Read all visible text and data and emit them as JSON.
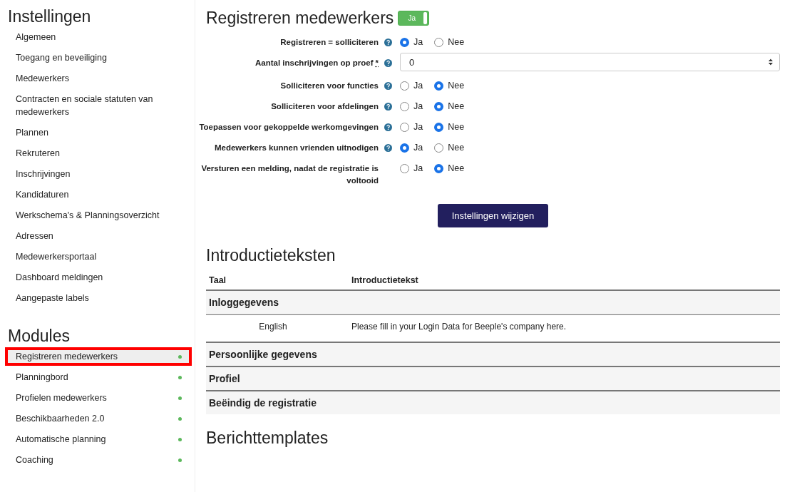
{
  "sidebar": {
    "sections": [
      {
        "title": "Instellingen",
        "items": [
          {
            "label": "Algemeen",
            "selected": false
          },
          {
            "label": "Toegang en beveiliging",
            "selected": false
          },
          {
            "label": "Medewerkers",
            "selected": false
          },
          {
            "label": "Contracten en sociale statuten van medewerkers",
            "selected": false
          },
          {
            "label": "Plannen",
            "selected": false
          },
          {
            "label": "Rekruteren",
            "selected": false
          },
          {
            "label": "Inschrijvingen",
            "selected": false
          },
          {
            "label": "Kandidaturen",
            "selected": false
          },
          {
            "label": "Werkschema's & Planningsoverzicht",
            "selected": false
          },
          {
            "label": "Adressen",
            "selected": false
          },
          {
            "label": "Medewerkersportaal",
            "selected": false
          },
          {
            "label": "Dashboard meldingen",
            "selected": false
          },
          {
            "label": "Aangepaste labels",
            "selected": false
          }
        ]
      },
      {
        "title": "Modules",
        "items": [
          {
            "label": "Registreren medewerkers",
            "selected": true,
            "active": true
          },
          {
            "label": "Planningbord",
            "selected": false,
            "active": true
          },
          {
            "label": "Profielen medewerkers",
            "selected": false,
            "active": true
          },
          {
            "label": "Beschikbaarheden 2.0",
            "selected": false,
            "active": true
          },
          {
            "label": "Automatische planning",
            "selected": false,
            "active": true
          },
          {
            "label": "Coaching",
            "selected": false,
            "active": true
          }
        ]
      }
    ]
  },
  "main": {
    "title": "Registreren medewerkers",
    "toggle": {
      "label": "Ja",
      "on": true
    },
    "settings": [
      {
        "kind": "radio",
        "label": "Registreren = solliciteren",
        "help": true,
        "options": [
          {
            "label": "Ja",
            "selected": true
          },
          {
            "label": "Nee",
            "selected": false
          }
        ]
      },
      {
        "kind": "number",
        "label": "Aantal inschrijvingen op proef",
        "required_mark": "*",
        "help": true,
        "value": "0"
      },
      {
        "kind": "radio",
        "label": "Solliciteren voor functies",
        "help": true,
        "options": [
          {
            "label": "Ja",
            "selected": false
          },
          {
            "label": "Nee",
            "selected": true
          }
        ]
      },
      {
        "kind": "radio",
        "label": "Solliciteren voor afdelingen",
        "help": true,
        "options": [
          {
            "label": "Ja",
            "selected": false
          },
          {
            "label": "Nee",
            "selected": true
          }
        ]
      },
      {
        "kind": "radio",
        "label": "Toepassen voor gekoppelde werkomgevingen",
        "help": true,
        "options": [
          {
            "label": "Ja",
            "selected": false
          },
          {
            "label": "Nee",
            "selected": true
          }
        ]
      },
      {
        "kind": "radio",
        "label": "Medewerkers kunnen vrienden uitnodigen",
        "help": true,
        "options": [
          {
            "label": "Ja",
            "selected": true
          },
          {
            "label": "Nee",
            "selected": false
          }
        ]
      },
      {
        "kind": "radio",
        "label": "Versturen een melding, nadat de registratie is voltooid",
        "help": false,
        "options": [
          {
            "label": "Ja",
            "selected": false
          },
          {
            "label": "Nee",
            "selected": true
          }
        ]
      }
    ],
    "submit": "Instellingen wijzigen",
    "intro": {
      "title": "Introductieteksten",
      "columns": [
        "Taal",
        "Introductietekst"
      ],
      "groups": [
        {
          "title": "Inloggegevens",
          "rows": [
            {
              "language": "English",
              "text": "Please fill in your Login Data for Beeple's company here."
            }
          ]
        },
        {
          "title": "Persoonlijke gegevens"
        },
        {
          "title": "Profiel"
        },
        {
          "title": "Beëindig de registratie"
        }
      ]
    },
    "next_title": "Berichttemplates"
  }
}
